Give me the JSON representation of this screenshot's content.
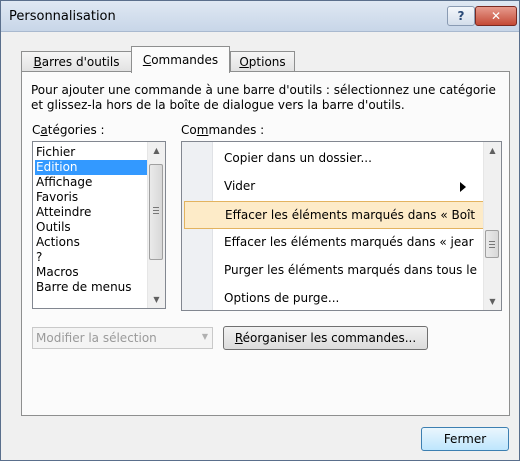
{
  "window": {
    "title": "Personnalisation",
    "help_label": "?",
    "close_label": "✕"
  },
  "tabs": [
    {
      "label": "Barres d'outils",
      "accel": "B",
      "rest": "arres d'outils",
      "active": false
    },
    {
      "label": "Commandes",
      "accel": "C",
      "rest": "ommandes",
      "active": true
    },
    {
      "label": "Options",
      "accel": "O",
      "rest": "ptions",
      "active": false
    }
  ],
  "description": "Pour ajouter une commande à une barre d'outils : sélectionnez une catégorie et glissez-la hors de la boîte de dialogue vers la barre d'outils.",
  "categories": {
    "label": "Catégories :",
    "label_pre": "C",
    "label_accel": "a",
    "label_post": "tégories :",
    "items": [
      "Fichier",
      "Edition",
      "Affichage",
      "Favoris",
      "Atteindre",
      "Outils",
      "Actions",
      "?",
      "Macros",
      "Barre de menus"
    ],
    "selected": "Edition"
  },
  "commands": {
    "label": "Commandes :",
    "label_pre": "Co",
    "label_accel": "m",
    "label_post": "mandes :",
    "items": [
      {
        "text": "Copier dans un dossier...",
        "submenu": false
      },
      {
        "text": "Vider",
        "submenu": true
      },
      {
        "text": "Effacer les éléments marqués dans « Boît",
        "submenu": false,
        "selected": true
      },
      {
        "text": "Effacer les éléments marqués dans « jear",
        "submenu": false
      },
      {
        "text": "Purger les éléments marqués dans tous le",
        "submenu": false
      },
      {
        "text": "Options de purge...",
        "submenu": false
      }
    ]
  },
  "modify_selection": {
    "value": "Modifier la sélection",
    "disabled": true
  },
  "reorganize_button": {
    "label": "Réorganiser les commandes...",
    "accel": "R",
    "rest": "éorganiser les commandes..."
  },
  "close_button": {
    "label": "Fermer"
  }
}
